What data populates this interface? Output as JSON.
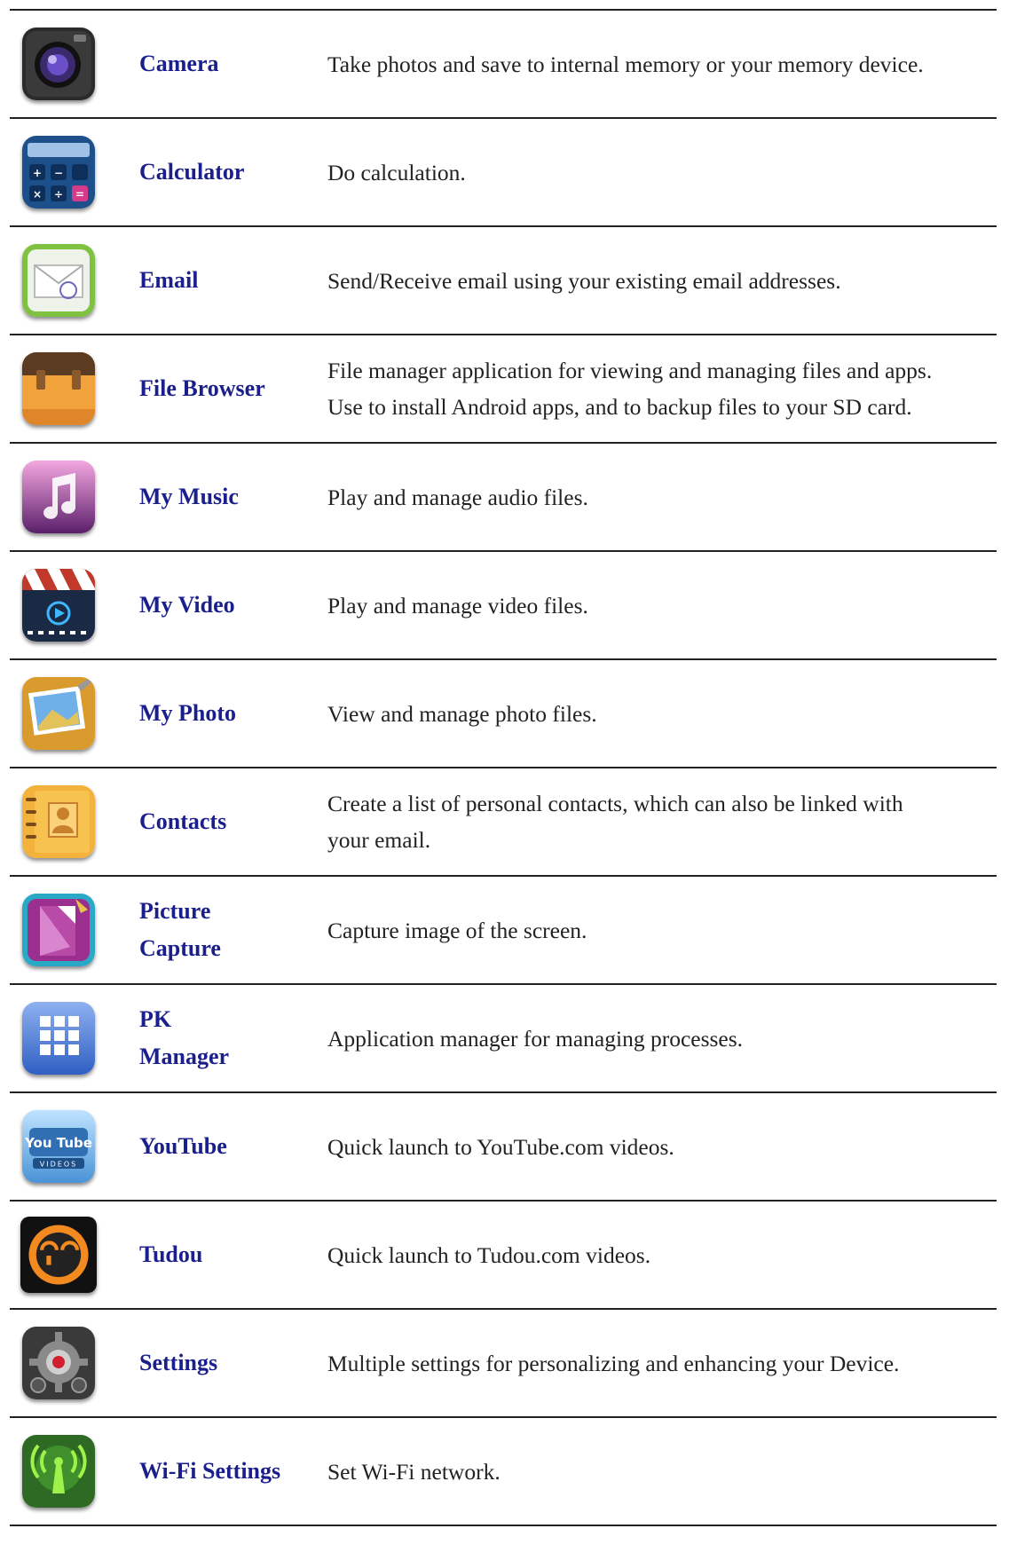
{
  "apps": [
    {
      "name": "Camera",
      "icon": "camera-icon",
      "desc": [
        "Take photos and save to internal memory or your memory device."
      ]
    },
    {
      "name": "Calculator",
      "icon": "calculator-icon",
      "desc": [
        "Do calculation."
      ]
    },
    {
      "name": "Email",
      "icon": "email-icon",
      "desc": [
        "Send/Receive email using your existing email addresses."
      ]
    },
    {
      "name": "File Browser",
      "icon": "file-browser-icon",
      "desc": [
        "File manager application for viewing and managing files and apps.",
        "Use to install Android apps, and to backup files to your SD card."
      ]
    },
    {
      "name": "My Music",
      "icon": "music-icon",
      "desc": [
        "Play and manage audio files."
      ]
    },
    {
      "name": "My Video",
      "icon": "video-icon",
      "desc": [
        "Play and manage video files."
      ]
    },
    {
      "name": "My Photo",
      "icon": "photo-icon",
      "desc": [
        "View and manage photo files."
      ]
    },
    {
      "name": "Contacts",
      "icon": "contacts-icon",
      "desc": [
        "Create a list of personal contacts, which can also be linked with",
        "your email."
      ]
    },
    {
      "name": "Picture Capture",
      "name_lines": [
        "Picture",
        "Capture"
      ],
      "icon": "picture-capture-icon",
      "desc": [
        "Capture image of the screen."
      ]
    },
    {
      "name": "PK Manager",
      "name_lines": [
        "PK",
        "Manager"
      ],
      "icon": "pk-manager-icon",
      "desc": [
        "Application manager for managing processes."
      ]
    },
    {
      "name": "YouTube",
      "icon": "youtube-icon",
      "icon_text": "You Tube",
      "icon_subtext": "VIDEOS",
      "desc": [
        "Quick launch to YouTube.com videos."
      ]
    },
    {
      "name": "Tudou",
      "icon": "tudou-icon",
      "desc": [
        "Quick launch to Tudou.com videos."
      ]
    },
    {
      "name": "Settings",
      "icon": "settings-icon",
      "desc": [
        "Multiple settings for personalizing and enhancing your Device."
      ]
    },
    {
      "name": "Wi-Fi Settings",
      "icon": "wifi-icon",
      "desc": [
        "Set Wi-Fi network."
      ]
    }
  ],
  "colors": {
    "name_text": "#1a1f8c",
    "desc_text": "#222222",
    "rule": "#222222"
  }
}
